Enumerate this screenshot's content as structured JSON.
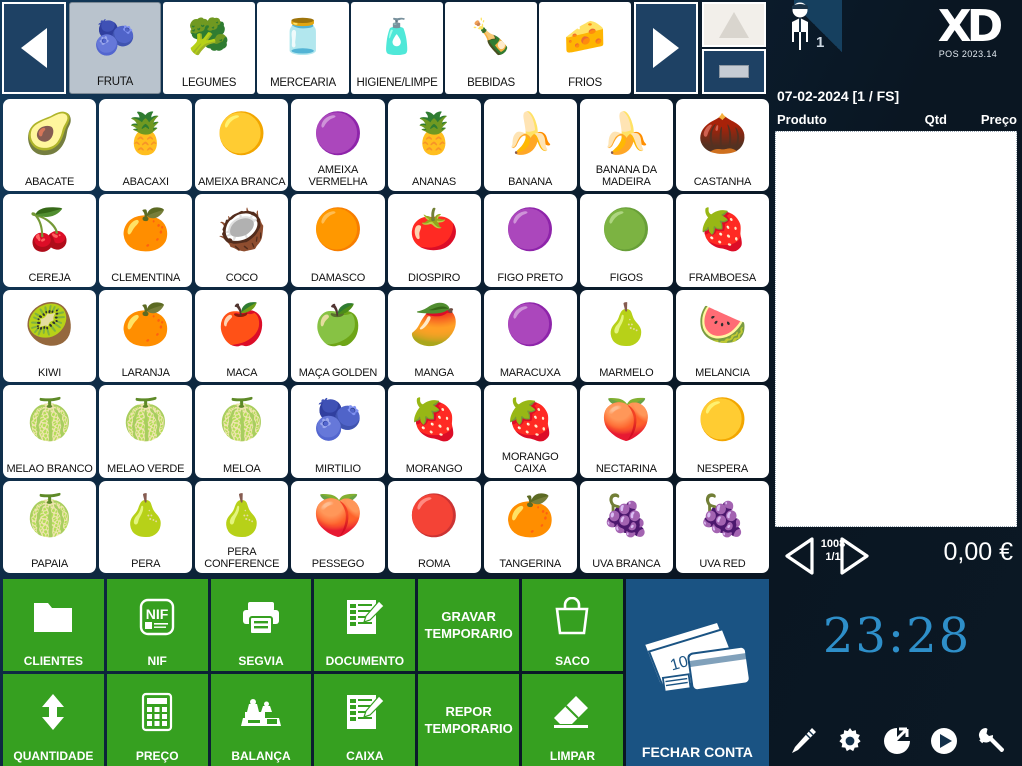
{
  "colors": {
    "background_navy": "#0b1a28",
    "accent_blue": "#1e4164",
    "action_green": "#36a020",
    "close_blue": "#1a5383",
    "clock_blue": "#2e8fc9",
    "selected_tab": "#b9c3cd"
  },
  "category_bar": {
    "prev_label": "prev-category",
    "next_label": "next-category",
    "selected": "FRUTA",
    "categories": [
      {
        "label": "FRUTA",
        "icon": "fruit-basket-icon",
        "selected": true
      },
      {
        "label": "LEGUMES",
        "icon": "vegetable-basket-icon",
        "selected": false
      },
      {
        "label": "MERCEARIA",
        "icon": "grocery-bottles-icon",
        "selected": false
      },
      {
        "label": "HIGIENE/LIMPE",
        "icon": "hygiene-bottles-icon",
        "selected": false
      },
      {
        "label": "BEBIDAS",
        "icon": "drinks-bottles-icon",
        "selected": false
      },
      {
        "label": "FRIOS",
        "icon": "cold-cuts-icon",
        "selected": false
      }
    ],
    "side_buttons": [
      {
        "name": "cone-filter-button",
        "icon": "cone-icon"
      },
      {
        "name": "keyboard-button",
        "icon": "bar-icon"
      }
    ]
  },
  "products": [
    {
      "label": "ABACATE",
      "icon": "avocado-icon"
    },
    {
      "label": "ABACAXI",
      "icon": "pineapple-icon"
    },
    {
      "label": "AMEIXA BRANCA",
      "icon": "yellow-plum-icon"
    },
    {
      "label": "AMEIXA VERMELHA",
      "icon": "red-plum-icon"
    },
    {
      "label": "ANANAS",
      "icon": "pineapple-icon"
    },
    {
      "label": "BANANA",
      "icon": "banana-icon"
    },
    {
      "label": "BANANA DA MADEIRA",
      "icon": "banana-bunch-icon"
    },
    {
      "label": "CASTANHA",
      "icon": "chestnut-icon"
    },
    {
      "label": "CEREJA",
      "icon": "cherry-icon"
    },
    {
      "label": "CLEMENTINA",
      "icon": "clementine-icon"
    },
    {
      "label": "COCO",
      "icon": "coconut-icon"
    },
    {
      "label": "DAMASCO",
      "icon": "apricot-icon"
    },
    {
      "label": "DIOSPIRO",
      "icon": "persimmon-icon"
    },
    {
      "label": "FIGO PRETO",
      "icon": "black-fig-icon"
    },
    {
      "label": "FIGOS",
      "icon": "green-fig-icon"
    },
    {
      "label": "FRAMBOESA",
      "icon": "raspberry-icon"
    },
    {
      "label": "KIWI",
      "icon": "kiwi-icon"
    },
    {
      "label": "LARANJA",
      "icon": "orange-icon"
    },
    {
      "label": "MACA",
      "icon": "red-apple-icon"
    },
    {
      "label": "MAÇA GOLDEN",
      "icon": "golden-apple-icon"
    },
    {
      "label": "MANGA",
      "icon": "mango-icon"
    },
    {
      "label": "MARACUXA",
      "icon": "passionfruit-icon"
    },
    {
      "label": "MARMELO",
      "icon": "quince-icon"
    },
    {
      "label": "MELANCIA",
      "icon": "watermelon-icon"
    },
    {
      "label": "MELAO BRANCO",
      "icon": "white-melon-icon"
    },
    {
      "label": "MELAO VERDE",
      "icon": "green-melon-icon"
    },
    {
      "label": "MELOA",
      "icon": "cantaloupe-icon"
    },
    {
      "label": "MIRTILIO",
      "icon": "blueberry-icon"
    },
    {
      "label": "MORANGO",
      "icon": "strawberry-icon"
    },
    {
      "label": "MORANGO CAIXA",
      "icon": "strawberry-box-icon"
    },
    {
      "label": "NECTARINA",
      "icon": "nectarine-icon"
    },
    {
      "label": "NESPERA",
      "icon": "loquat-icon"
    },
    {
      "label": "PAPAIA",
      "icon": "papaya-icon"
    },
    {
      "label": "PERA",
      "icon": "pear-icon"
    },
    {
      "label": "PERA CONFERENCE",
      "icon": "conference-pear-icon"
    },
    {
      "label": "PESSEGO",
      "icon": "peach-icon"
    },
    {
      "label": "ROMA",
      "icon": "pomegranate-icon"
    },
    {
      "label": "TANGERINA",
      "icon": "tangerine-icon"
    },
    {
      "label": "UVA BRANCA",
      "icon": "green-grapes-icon"
    },
    {
      "label": "UVA RED",
      "icon": "red-grapes-icon"
    }
  ],
  "actions": [
    {
      "label": "CLIENTES",
      "icon": "folder-icon",
      "style": "green"
    },
    {
      "label": "NIF",
      "icon": "nif-card-icon",
      "style": "green"
    },
    {
      "label": "SEGVIA",
      "icon": "printer-icon",
      "style": "green"
    },
    {
      "label": "DOCUMENTO",
      "icon": "document-edit-icon",
      "style": "green"
    },
    {
      "label": "GRAVAR TEMPORARIO",
      "icon": "",
      "style": "green-text"
    },
    {
      "label": "SACO",
      "icon": "bag-icon",
      "style": "green"
    },
    {
      "label": "QUANTIDADE",
      "icon": "up-down-arrows-icon",
      "style": "green"
    },
    {
      "label": "PREÇO",
      "icon": "calculator-icon",
      "style": "green"
    },
    {
      "label": "BALANÇA",
      "icon": "scale-icon",
      "style": "green"
    },
    {
      "label": "CAIXA",
      "icon": "document-edit-icon",
      "style": "green"
    },
    {
      "label": "REPOR TEMPORARIO",
      "icon": "",
      "style": "green-text"
    },
    {
      "label": "LIMPAR",
      "icon": "eraser-icon",
      "style": "green"
    }
  ],
  "close_account": {
    "label": "FECHAR CONTA",
    "icon": "cash-card-icon",
    "note": "100"
  },
  "right_panel": {
    "operator_icon": "operator-person-icon",
    "operator_number": "1",
    "logo_text": "XD",
    "version": "POS 2023.14",
    "document_line": "07-02-2024 [1 / FS]",
    "columns": {
      "product": "Produto",
      "qty": "Qtd",
      "price": "Preço"
    },
    "receipt_rows": [],
    "pager": {
      "id": "1008",
      "page": "1/1",
      "prev_icon": "left-triangle-icon",
      "next_icon": "right-triangle-icon"
    },
    "total": "0,00 €",
    "clock": "23:28",
    "tools": [
      {
        "name": "pencil-icon",
        "label": "pencil"
      },
      {
        "name": "gear-icon",
        "label": "gear"
      },
      {
        "name": "pie-logout-icon",
        "label": "pie"
      },
      {
        "name": "play-circle-icon",
        "label": "play"
      },
      {
        "name": "wrench-icon",
        "label": "wrench"
      }
    ]
  }
}
